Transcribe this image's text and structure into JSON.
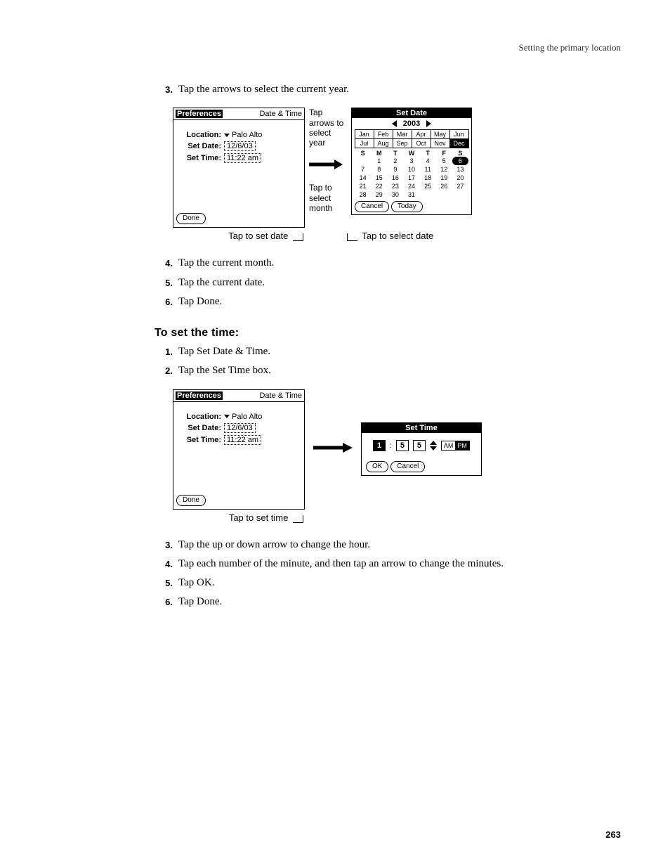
{
  "header": {
    "running": "Setting the primary location"
  },
  "steps_a": [
    {
      "n": "3.",
      "t": "Tap the arrows to select the current year."
    }
  ],
  "steps_b": [
    {
      "n": "4.",
      "t": "Tap the current month."
    },
    {
      "n": "5.",
      "t": "Tap the current date."
    },
    {
      "n": "6.",
      "t": "Tap Done."
    }
  ],
  "subheading": "To set the time:",
  "steps_c": [
    {
      "n": "1.",
      "t": "Tap Set Date & Time."
    },
    {
      "n": "2.",
      "t": "Tap the Set Time box."
    }
  ],
  "steps_d": [
    {
      "n": "3.",
      "t": "Tap the up or down arrow to change the hour."
    },
    {
      "n": "4.",
      "t": "Tap each number of the minute, and then tap an arrow to change the minutes."
    },
    {
      "n": "5.",
      "t": "Tap OK."
    },
    {
      "n": "6.",
      "t": "Tap Done."
    }
  ],
  "prefs": {
    "title": "Preferences",
    "category": "Date & Time",
    "location_label": "Location:",
    "location_value": "Palo Alto",
    "setdate_label": "Set Date:",
    "setdate_value": "12/6/03",
    "settime_label": "Set Time:",
    "settime_value": "11:22 am",
    "done": "Done"
  },
  "fig1_callouts": {
    "year": "Tap arrows to select year",
    "month": "Tap to select month",
    "bottom_left": "Tap to set date",
    "bottom_right": "Tap to select date"
  },
  "setdate": {
    "title": "Set Date",
    "year": "2003",
    "months": [
      "Jan",
      "Feb",
      "Mar",
      "Apr",
      "May",
      "Jun",
      "Jul",
      "Aug",
      "Sep",
      "Oct",
      "Nov",
      "Dec"
    ],
    "selected_month_index": 11,
    "dow": [
      "S",
      "M",
      "T",
      "W",
      "T",
      "F",
      "S"
    ],
    "weeks": [
      [
        "",
        "1",
        "2",
        "3",
        "4",
        "5",
        "6"
      ],
      [
        "7",
        "8",
        "9",
        "10",
        "11",
        "12",
        "13"
      ],
      [
        "14",
        "15",
        "16",
        "17",
        "18",
        "19",
        "20"
      ],
      [
        "21",
        "22",
        "23",
        "24",
        "25",
        "26",
        "27"
      ],
      [
        "28",
        "29",
        "30",
        "31",
        "",
        "",
        ""
      ]
    ],
    "selected_day": "6",
    "cancel": "Cancel",
    "today": "Today"
  },
  "fig2_caption": "Tap to set time",
  "settime": {
    "title": "Set Time",
    "hour": "1",
    "min1": "5",
    "min2": "5",
    "am": "AM",
    "pm": "PM",
    "ok": "OK",
    "cancel": "Cancel"
  },
  "page_number": "263"
}
